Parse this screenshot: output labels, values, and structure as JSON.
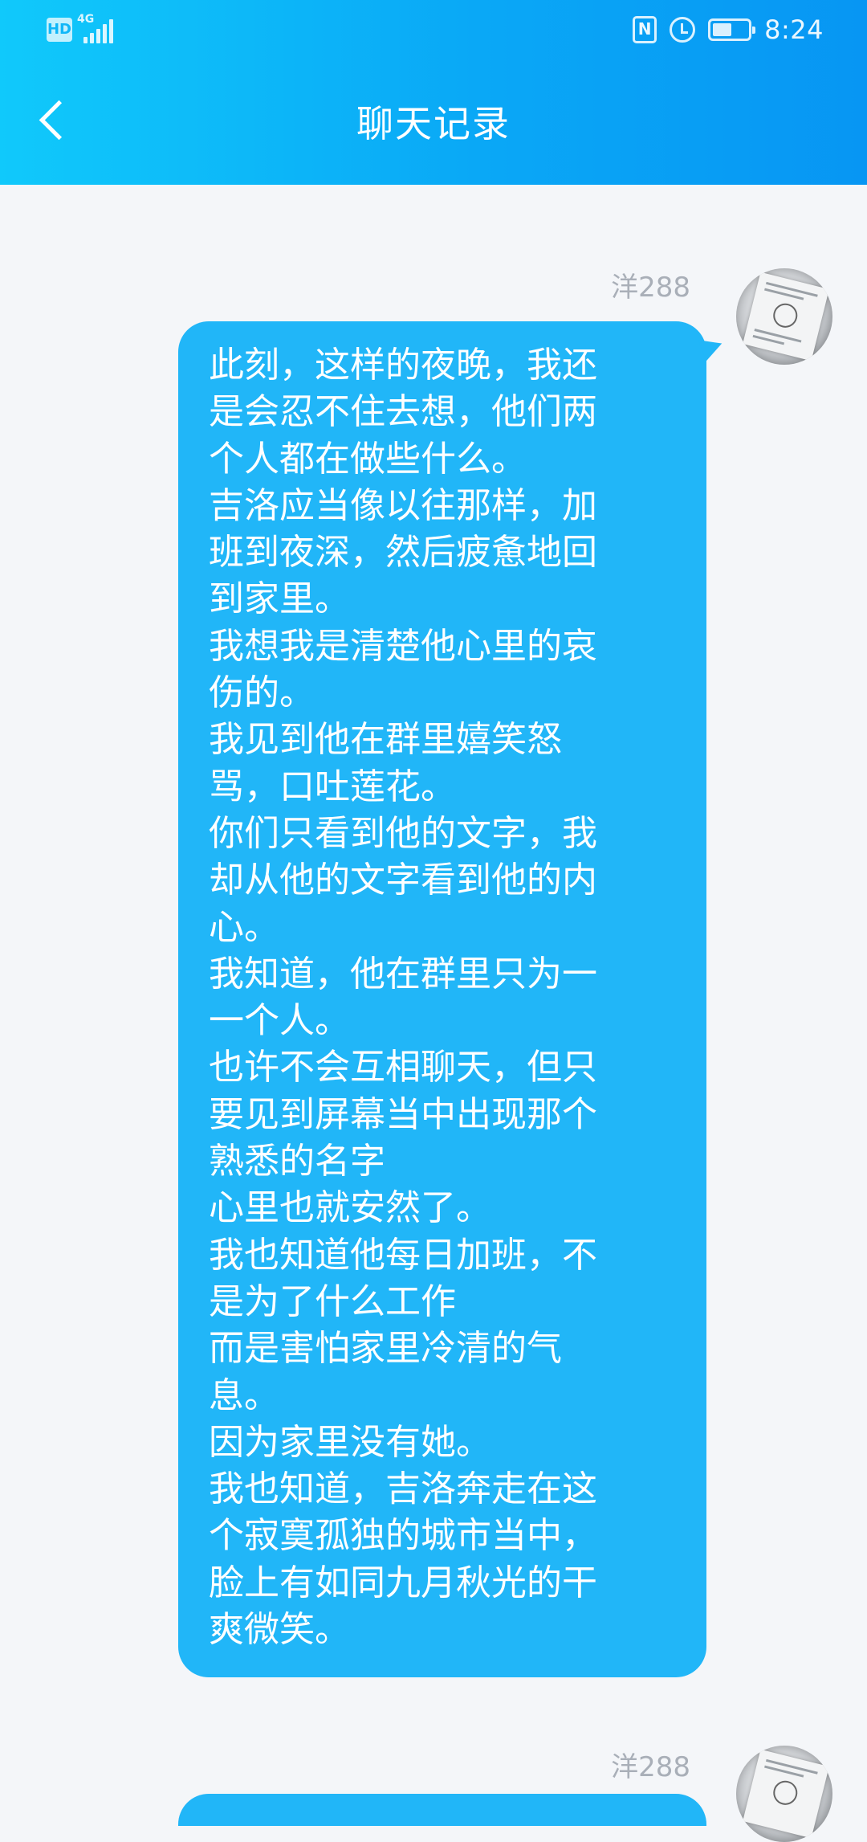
{
  "status_bar": {
    "hd": "HD",
    "network": "4G",
    "time": "8:24",
    "battery_level": 0.55
  },
  "header": {
    "title": "聊天记录"
  },
  "messages": [
    {
      "sender": "洋288",
      "lines": [
        "此刻，这样的夜晚，我还",
        "是会忍不住去想，他们两",
        "个人都在做些什么。",
        "吉洛应当像以往那样，加",
        "班到夜深，然后疲惫地回",
        "到家里。",
        "我想我是清楚他心里的哀",
        "伤的。",
        "我见到他在群里嬉笑怒",
        "骂，口吐莲花。",
        "你们只看到他的文字，我",
        "却从他的文字看到他的内",
        "心。",
        "我知道，他在群里只为一",
        "一个人。",
        "也许不会互相聊天，但只",
        "要见到屏幕当中出现那个",
        "熟悉的名字",
        "心里也就安然了。",
        "我也知道他每日加班，不",
        "是为了什么工作",
        "而是害怕家里冷清的气",
        "息。",
        "因为家里没有她。",
        "我也知道，吉洛奔走在这",
        "个寂寞孤独的城市当中，",
        "脸上有如同九月秋光的干",
        "爽微笑。"
      ]
    },
    {
      "sender": "洋288",
      "lines": []
    }
  ]
}
